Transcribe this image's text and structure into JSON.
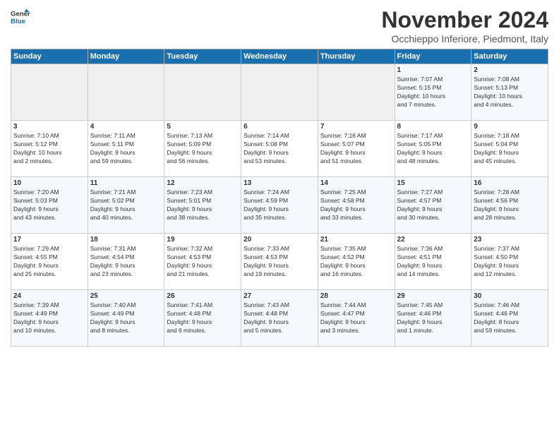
{
  "header": {
    "logo_line1": "General",
    "logo_line2": "Blue",
    "month": "November 2024",
    "location": "Occhieppo Inferiore, Piedmont, Italy"
  },
  "weekdays": [
    "Sunday",
    "Monday",
    "Tuesday",
    "Wednesday",
    "Thursday",
    "Friday",
    "Saturday"
  ],
  "weeks": [
    [
      {
        "day": "",
        "info": ""
      },
      {
        "day": "",
        "info": ""
      },
      {
        "day": "",
        "info": ""
      },
      {
        "day": "",
        "info": ""
      },
      {
        "day": "",
        "info": ""
      },
      {
        "day": "1",
        "info": "Sunrise: 7:07 AM\nSunset: 5:15 PM\nDaylight: 10 hours\nand 7 minutes."
      },
      {
        "day": "2",
        "info": "Sunrise: 7:08 AM\nSunset: 5:13 PM\nDaylight: 10 hours\nand 4 minutes."
      }
    ],
    [
      {
        "day": "3",
        "info": "Sunrise: 7:10 AM\nSunset: 5:12 PM\nDaylight: 10 hours\nand 2 minutes."
      },
      {
        "day": "4",
        "info": "Sunrise: 7:11 AM\nSunset: 5:11 PM\nDaylight: 9 hours\nand 59 minutes."
      },
      {
        "day": "5",
        "info": "Sunrise: 7:13 AM\nSunset: 5:09 PM\nDaylight: 9 hours\nand 56 minutes."
      },
      {
        "day": "6",
        "info": "Sunrise: 7:14 AM\nSunset: 5:08 PM\nDaylight: 9 hours\nand 53 minutes."
      },
      {
        "day": "7",
        "info": "Sunrise: 7:16 AM\nSunset: 5:07 PM\nDaylight: 9 hours\nand 51 minutes."
      },
      {
        "day": "8",
        "info": "Sunrise: 7:17 AM\nSunset: 5:05 PM\nDaylight: 9 hours\nand 48 minutes."
      },
      {
        "day": "9",
        "info": "Sunrise: 7:18 AM\nSunset: 5:04 PM\nDaylight: 9 hours\nand 45 minutes."
      }
    ],
    [
      {
        "day": "10",
        "info": "Sunrise: 7:20 AM\nSunset: 5:03 PM\nDaylight: 9 hours\nand 43 minutes."
      },
      {
        "day": "11",
        "info": "Sunrise: 7:21 AM\nSunset: 5:02 PM\nDaylight: 9 hours\nand 40 minutes."
      },
      {
        "day": "12",
        "info": "Sunrise: 7:23 AM\nSunset: 5:01 PM\nDaylight: 9 hours\nand 38 minutes."
      },
      {
        "day": "13",
        "info": "Sunrise: 7:24 AM\nSunset: 4:59 PM\nDaylight: 9 hours\nand 35 minutes."
      },
      {
        "day": "14",
        "info": "Sunrise: 7:25 AM\nSunset: 4:58 PM\nDaylight: 9 hours\nand 33 minutes."
      },
      {
        "day": "15",
        "info": "Sunrise: 7:27 AM\nSunset: 4:57 PM\nDaylight: 9 hours\nand 30 minutes."
      },
      {
        "day": "16",
        "info": "Sunrise: 7:28 AM\nSunset: 4:56 PM\nDaylight: 9 hours\nand 28 minutes."
      }
    ],
    [
      {
        "day": "17",
        "info": "Sunrise: 7:29 AM\nSunset: 4:55 PM\nDaylight: 9 hours\nand 25 minutes."
      },
      {
        "day": "18",
        "info": "Sunrise: 7:31 AM\nSunset: 4:54 PM\nDaylight: 9 hours\nand 23 minutes."
      },
      {
        "day": "19",
        "info": "Sunrise: 7:32 AM\nSunset: 4:53 PM\nDaylight: 9 hours\nand 21 minutes."
      },
      {
        "day": "20",
        "info": "Sunrise: 7:33 AM\nSunset: 4:53 PM\nDaylight: 9 hours\nand 19 minutes."
      },
      {
        "day": "21",
        "info": "Sunrise: 7:35 AM\nSunset: 4:52 PM\nDaylight: 9 hours\nand 16 minutes."
      },
      {
        "day": "22",
        "info": "Sunrise: 7:36 AM\nSunset: 4:51 PM\nDaylight: 9 hours\nand 14 minutes."
      },
      {
        "day": "23",
        "info": "Sunrise: 7:37 AM\nSunset: 4:50 PM\nDaylight: 9 hours\nand 12 minutes."
      }
    ],
    [
      {
        "day": "24",
        "info": "Sunrise: 7:39 AM\nSunset: 4:49 PM\nDaylight: 9 hours\nand 10 minutes."
      },
      {
        "day": "25",
        "info": "Sunrise: 7:40 AM\nSunset: 4:49 PM\nDaylight: 9 hours\nand 8 minutes."
      },
      {
        "day": "26",
        "info": "Sunrise: 7:41 AM\nSunset: 4:48 PM\nDaylight: 9 hours\nand 6 minutes."
      },
      {
        "day": "27",
        "info": "Sunrise: 7:43 AM\nSunset: 4:48 PM\nDaylight: 9 hours\nand 5 minutes."
      },
      {
        "day": "28",
        "info": "Sunrise: 7:44 AM\nSunset: 4:47 PM\nDaylight: 9 hours\nand 3 minutes."
      },
      {
        "day": "29",
        "info": "Sunrise: 7:45 AM\nSunset: 4:46 PM\nDaylight: 9 hours\nand 1 minute."
      },
      {
        "day": "30",
        "info": "Sunrise: 7:46 AM\nSunset: 4:46 PM\nDaylight: 8 hours\nand 59 minutes."
      }
    ]
  ]
}
